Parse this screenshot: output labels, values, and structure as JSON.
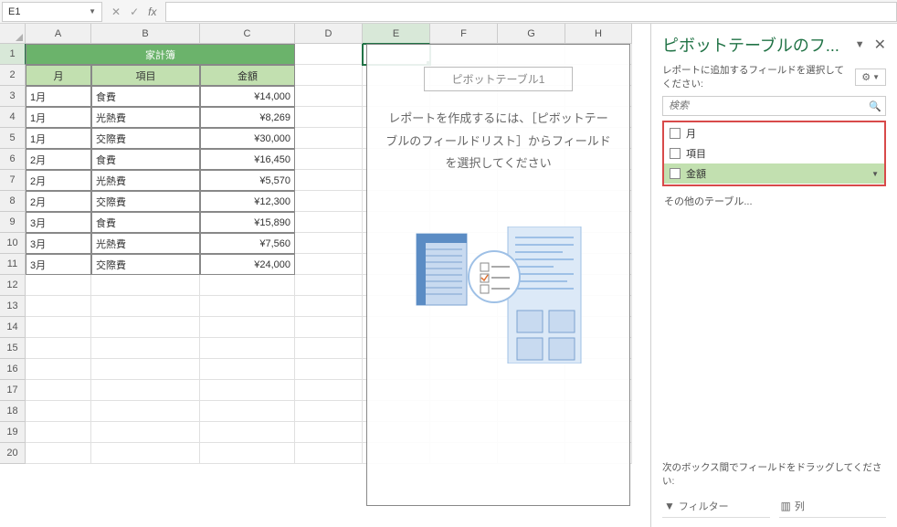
{
  "namebox": "E1",
  "columns": [
    "A",
    "B",
    "C",
    "D",
    "E",
    "F",
    "G",
    "H"
  ],
  "title": "家計簿",
  "headers": {
    "A": "月",
    "B": "項目",
    "C": "金額"
  },
  "rows": [
    {
      "A": "1月",
      "B": "食費",
      "C": "¥14,000"
    },
    {
      "A": "1月",
      "B": "光熱費",
      "C": "¥8,269"
    },
    {
      "A": "1月",
      "B": "交際費",
      "C": "¥30,000"
    },
    {
      "A": "2月",
      "B": "食費",
      "C": "¥16,450"
    },
    {
      "A": "2月",
      "B": "光熱費",
      "C": "¥5,570"
    },
    {
      "A": "2月",
      "B": "交際費",
      "C": "¥12,300"
    },
    {
      "A": "3月",
      "B": "食費",
      "C": "¥15,890"
    },
    {
      "A": "3月",
      "B": "光熱費",
      "C": "¥7,560"
    },
    {
      "A": "3月",
      "B": "交際費",
      "C": "¥24,000"
    }
  ],
  "pivot": {
    "title": "ピボットテーブル1",
    "msg": "レポートを作成するには、［ピボットテーブルのフィールドリスト］からフィールドを選択してください"
  },
  "pane": {
    "title": "ピボットテーブルのフ...",
    "sub": "レポートに追加するフィールドを選択してください:",
    "search_placeholder": "検索",
    "fields": [
      "月",
      "項目",
      "金額"
    ],
    "other": "その他のテーブル...",
    "drag_hint": "次のボックス間でフィールドをドラッグしてください:",
    "zones": {
      "filter": "フィルター",
      "columns": "列"
    }
  }
}
